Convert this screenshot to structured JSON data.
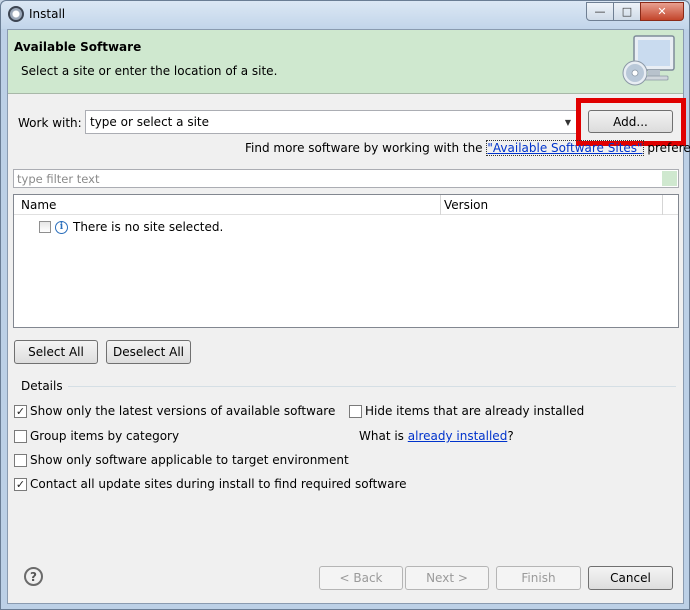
{
  "window": {
    "title": "Install",
    "controls": {
      "minimize": "—",
      "maximize": "□",
      "close": "✕"
    }
  },
  "header": {
    "title": "Available Software",
    "description": "Select a site or enter the location of a site."
  },
  "work_with": {
    "label": "Work with:",
    "value": "type or select a site",
    "add_button": "Add..."
  },
  "find_more": {
    "prefix": "Find more software by working with the ",
    "link": "\"Available Software Sites\"",
    "suffix": " preferences."
  },
  "filter": {
    "placeholder": "type filter text"
  },
  "table": {
    "columns": [
      "Name",
      "Version"
    ],
    "message": "There is no site selected."
  },
  "selection_buttons": {
    "select_all": "Select All",
    "deselect_all": "Deselect All"
  },
  "details": {
    "label": "Details",
    "options": {
      "latest_versions": {
        "label": "Show only the latest versions of available software",
        "checked": true
      },
      "hide_installed": {
        "label": "Hide items that are already installed",
        "checked": false
      },
      "group_by_category": {
        "label": "Group items by category",
        "checked": false
      },
      "target_env": {
        "label": "Show only software applicable to target environment",
        "checked": false
      },
      "contact_sites": {
        "label": "Contact all update sites during install to find required software",
        "checked": true
      }
    },
    "what_is": {
      "prefix": "What is ",
      "link": "already installed",
      "suffix": "?"
    }
  },
  "footer": {
    "back": "< Back",
    "next": "Next >",
    "finish": "Finish",
    "cancel": "Cancel",
    "help_glyph": "?"
  },
  "colors": {
    "header_bg": "#cfe8cf",
    "highlight": "#e00000",
    "link": "#0033cc"
  }
}
